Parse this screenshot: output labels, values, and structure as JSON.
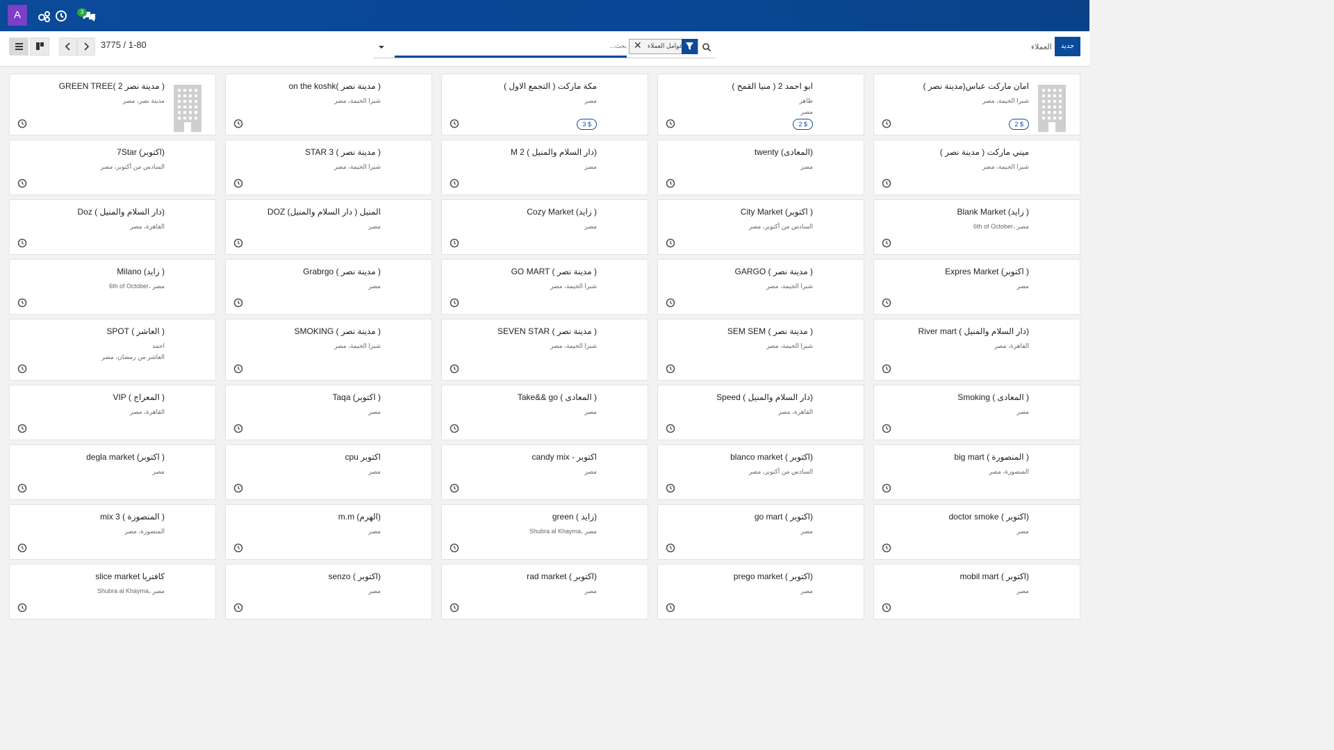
{
  "navbar": {
    "avatar_letter": "A",
    "badge_count": "3",
    "icons": [
      "users-cog-icon",
      "clock-icon",
      "chat-icon"
    ]
  },
  "control": {
    "pager": "3775 / 1-80",
    "facet_label": "عوامل العملاء",
    "search_placeholder": "...بحث",
    "new_button": "جديد",
    "breadcrumb": "العملاء"
  },
  "cards": [
    {
      "title": "امان ماركت عباس(مدينة نصر )",
      "l1": "شبرا الخيمة، مصر",
      "l2": "",
      "money": "2 $",
      "image": true
    },
    {
      "title": "ابو احمد 2 ( منيا القمح )",
      "l1": "طاهر",
      "l2": "مصر",
      "money": "2 $",
      "image": false
    },
    {
      "title": "مكة ماركت ( التجمع الاول )",
      "l1": "مصر",
      "l2": "",
      "money": "3 $",
      "image": false
    },
    {
      "title": "on the koshk( مدينة نصر )",
      "l1": "شبرا الخيمة، مصر",
      "l2": "",
      "money": "",
      "image": false
    },
    {
      "title": "GREEN TREE( 2 مدينة نصر )",
      "l1": "مدينة نصر، مصر",
      "l2": "",
      "money": "",
      "image": true
    },
    {
      "title": "ميني ماركت ( مدينة نصر )",
      "l1": "شبرا الخيمة، مصر",
      "l2": "",
      "money": "",
      "image": false
    },
    {
      "title": "twenty (المعادى)",
      "l1": "مصر",
      "l2": "",
      "money": "",
      "image": false
    },
    {
      "title": "M 2 ( دار السلام والمنيل)",
      "l1": "مصر",
      "l2": "",
      "money": "",
      "image": false
    },
    {
      "title": "STAR 3 ( مدينة نصر )",
      "l1": "شبرا الخيمة، مصر",
      "l2": "",
      "money": "",
      "image": false
    },
    {
      "title": "7Star (اكتوبر)",
      "l1": "السادس من أكتوبر، مصر",
      "l2": "",
      "money": "",
      "image": false
    },
    {
      "title": "Blank Market (زايد )",
      "l1": "6th of October، مصر",
      "l2": "",
      "money": "",
      "image": false
    },
    {
      "title": "City Market (اكتوبر )",
      "l1": "السادس من أكتوبر، مصر",
      "l2": "",
      "money": "",
      "image": false
    },
    {
      "title": "Cozy Market (زايد )",
      "l1": "مصر",
      "l2": "",
      "money": "",
      "image": false
    },
    {
      "title": "DOZ المنيل ( دار السلام والمنيل)",
      "l1": "مصر",
      "l2": "",
      "money": "",
      "image": false
    },
    {
      "title": "Doz ( دار السلام والمنيل)",
      "l1": "القاهرة، مصر",
      "l2": "",
      "money": "",
      "image": false
    },
    {
      "title": "Expres Market (اكتوبر )",
      "l1": "مصر",
      "l2": "",
      "money": "",
      "image": false
    },
    {
      "title": "GARGO ( مدينة نصر )",
      "l1": "شبرا الخيمة، مصر",
      "l2": "",
      "money": "",
      "image": false
    },
    {
      "title": "GO MART ( مدينة نصر )",
      "l1": "شبرا الخيمة، مصر",
      "l2": "",
      "money": "",
      "image": false
    },
    {
      "title": "Grabrgo ( مدينة نصر )",
      "l1": "مصر",
      "l2": "",
      "money": "",
      "image": false
    },
    {
      "title": "Milano (زايد )",
      "l1": "6th of October، مصر",
      "l2": "",
      "money": "",
      "image": false
    },
    {
      "title": "River mart ( دار السلام والمنيل)",
      "l1": "القاهرة، مصر",
      "l2": "",
      "money": "",
      "image": false
    },
    {
      "title": "SEM SEM ( مدينة نصر )",
      "l1": "شبرا الخيمة، مصر",
      "l2": "",
      "money": "",
      "image": false
    },
    {
      "title": "SEVEN STAR ( مدينة نصر )",
      "l1": "شبرا الخيمة، مصر",
      "l2": "",
      "money": "",
      "image": false
    },
    {
      "title": "SMOKING ( مدينة نصر )",
      "l1": "شبرا الخيمة، مصر",
      "l2": "",
      "money": "",
      "image": false
    },
    {
      "title": "SPOT ( العاشر )",
      "l1": "احمد",
      "l2": "العاشر من رمضان، مصر",
      "money": "",
      "image": false
    },
    {
      "title": "Smoking ( المعادى )",
      "l1": "مصر",
      "l2": "",
      "money": "",
      "image": false
    },
    {
      "title": "Speed ( دار السلام والمنيل)",
      "l1": "القاهرة، مصر",
      "l2": "",
      "money": "",
      "image": false
    },
    {
      "title": "Take&& go ( المعادى )",
      "l1": "مصر",
      "l2": "",
      "money": "",
      "image": false
    },
    {
      "title": "Taqa (اكتوبر )",
      "l1": "مصر",
      "l2": "",
      "money": "",
      "image": false
    },
    {
      "title": "VIP ( المعراج )",
      "l1": "القاهرة، مصر",
      "l2": "",
      "money": "",
      "image": false
    },
    {
      "title": "big mart ( المنصورة )",
      "l1": "المنصورة، مصر",
      "l2": "",
      "money": "",
      "image": false
    },
    {
      "title": "blanco market ( اكتوبر)",
      "l1": "السادس من أكتوبر، مصر",
      "l2": "",
      "money": "",
      "image": false
    },
    {
      "title": "candy mix - اكتوبر",
      "l1": "مصر",
      "l2": "",
      "money": "",
      "image": false
    },
    {
      "title": "cpu اكتوبر",
      "l1": "مصر",
      "l2": "",
      "money": "",
      "image": false
    },
    {
      "title": "degla market (اكتوبر )",
      "l1": "مصر",
      "l2": "",
      "money": "",
      "image": false
    },
    {
      "title": "doctor smoke ( اكتوبر)",
      "l1": "مصر",
      "l2": "",
      "money": "",
      "image": false
    },
    {
      "title": "go mart ( اكتوبر)",
      "l1": "مصر",
      "l2": "",
      "money": "",
      "image": false
    },
    {
      "title": "green ( زايد)",
      "l1": "Shubra al Khayma، مصر",
      "l2": "",
      "money": "",
      "image": false
    },
    {
      "title": "m.m (الهرم)",
      "l1": "مصر",
      "l2": "",
      "money": "",
      "image": false
    },
    {
      "title": "mix 3 ( المنصورة )",
      "l1": "المنصورة، مصر",
      "l2": "",
      "money": "",
      "image": false
    },
    {
      "title": "mobil mart ( اكتوبر)",
      "l1": "مصر",
      "l2": "",
      "money": "",
      "image": false
    },
    {
      "title": "prego market ( اكتوبر)",
      "l1": "مصر",
      "l2": "",
      "money": "",
      "image": false
    },
    {
      "title": "rad market ( اكتوبر)",
      "l1": "مصر",
      "l2": "",
      "money": "",
      "image": false
    },
    {
      "title": "senzo ( اكتوبر)",
      "l1": "مصر",
      "l2": "",
      "money": "",
      "image": false
    },
    {
      "title": "slice market كافتريا",
      "l1": "Shubra al Khayma، مصر",
      "l2": "",
      "money": "",
      "image": false
    }
  ]
}
